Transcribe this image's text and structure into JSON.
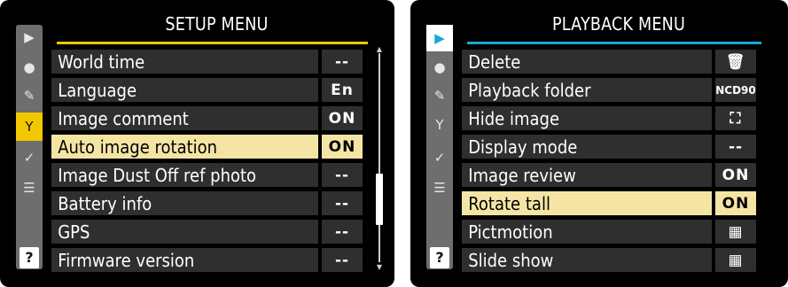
{
  "setup": {
    "title": "SETUP MENU",
    "accent": "#f0c700",
    "rows": [
      {
        "label": "World time",
        "value": "--"
      },
      {
        "label": "Language",
        "value": "En"
      },
      {
        "label": "Image comment",
        "value": "ON"
      },
      {
        "label": "Auto image rotation",
        "value": "ON"
      },
      {
        "label": "Image Dust Off ref photo",
        "value": "--"
      },
      {
        "label": "Battery info",
        "value": "--"
      },
      {
        "label": "GPS",
        "value": "--"
      },
      {
        "label": "Firmware version",
        "value": "--"
      }
    ],
    "selected_index": 3,
    "icons": {
      "playback": "▶",
      "shooting": "●",
      "custom": "✎",
      "setup": "Y",
      "retouch": "✓",
      "recent": "☰",
      "help": "?"
    }
  },
  "playback": {
    "title": "PLAYBACK MENU",
    "accent": "#1ba7d4",
    "rows": [
      {
        "label": "Delete",
        "value": "🗑"
      },
      {
        "label": "Playback folder",
        "value": "NCD90"
      },
      {
        "label": "Hide image",
        "value": "⛶"
      },
      {
        "label": "Display mode",
        "value": "--"
      },
      {
        "label": "Image review",
        "value": "ON"
      },
      {
        "label": "Rotate tall",
        "value": "ON"
      },
      {
        "label": "Pictmotion",
        "value": "▦"
      },
      {
        "label": "Slide show",
        "value": "▦"
      }
    ],
    "selected_index": 5,
    "icons": {
      "playback": "▶",
      "shooting": "●",
      "custom": "✎",
      "setup": "Y",
      "retouch": "✓",
      "recent": "☰",
      "help": "?"
    }
  }
}
